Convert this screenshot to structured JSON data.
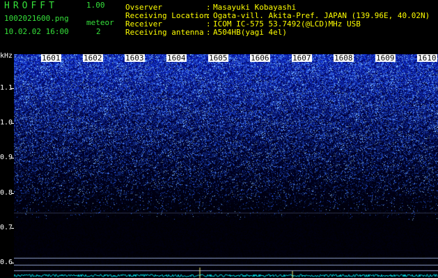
{
  "header": {
    "app_title": "HROFFT",
    "version": "1.00",
    "filename": "1002021600.png",
    "timestamp": "10.02.02 16:00",
    "meteor_label": "meteor",
    "meteor_count": "2",
    "info": [
      {
        "label": "Ovserver",
        "value": "Masayuki Kobayashi"
      },
      {
        "label": "Receiving Location",
        "value": "Ogata-vill. Akita-Pref. JAPAN (139.96E, 40.02N)"
      },
      {
        "label": "Receiver",
        "value": "ICOM IC-575 53.7492(@LCD)MHz USB"
      },
      {
        "label": "Receiving antenna",
        "value": "A504HB(yagi 4el)"
      }
    ]
  },
  "axis": {
    "unit": "kHz",
    "y_labels": [
      "1.1",
      "1.0",
      "0.9",
      "0.8",
      "0.7",
      "0.6"
    ],
    "time_labels": [
      "1601",
      "1602",
      "1603",
      "1604",
      "1605",
      "1606",
      "1607",
      "1608",
      "1609",
      "1610"
    ]
  },
  "colors": {
    "background": "#000000",
    "green_text": "#35e03a",
    "yellow_text": "#ffff00",
    "noise_bright": "#4b7bff",
    "noise_dark": "#0a1a66",
    "trace": "#00e0e0"
  }
}
